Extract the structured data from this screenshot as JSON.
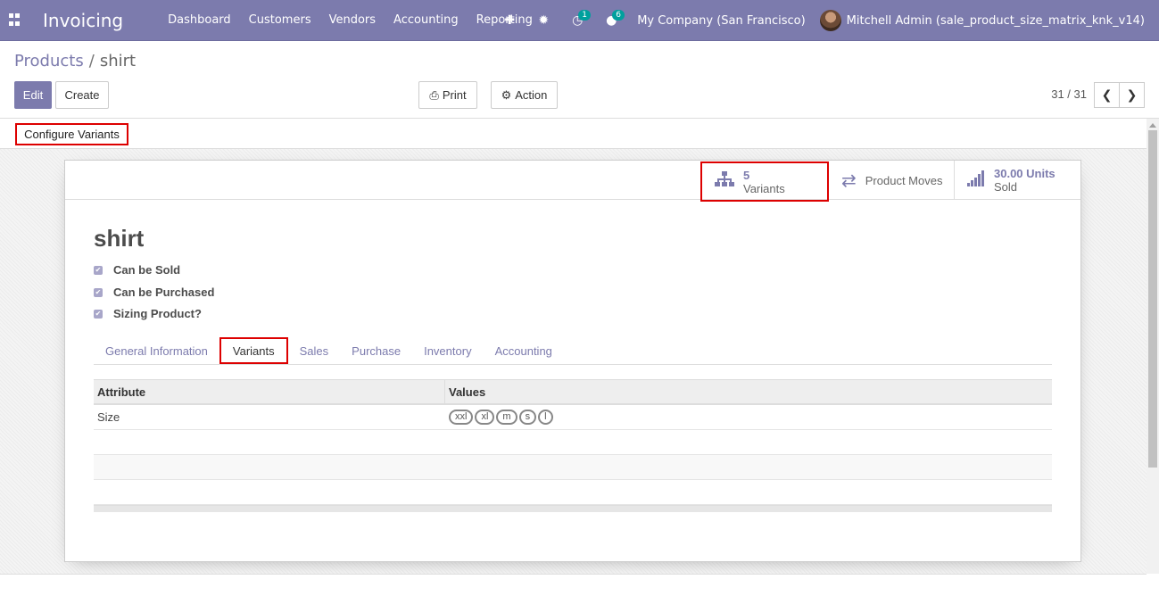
{
  "navbar": {
    "brand": "Invoicing",
    "menu": [
      "Dashboard",
      "Customers",
      "Vendors",
      "Accounting",
      "Reporting"
    ],
    "activity_count": "1",
    "message_count": "6",
    "company": "My Company (San Francisco)",
    "user": "Mitchell Admin (sale_product_size_matrix_knk_v14)"
  },
  "breadcrumb": {
    "parent": "Products",
    "separator": "/",
    "current": "shirt"
  },
  "buttons": {
    "edit": "Edit",
    "create": "Create",
    "print": "Print",
    "action": "Action",
    "configure_variants": "Configure Variants"
  },
  "pager": {
    "value": "31 / 31"
  },
  "stat_buttons": {
    "variants_count": "5",
    "variants_label": "Variants",
    "moves_label": "Product Moves",
    "sold_value": "30.00 Units",
    "sold_label": "Sold"
  },
  "product": {
    "name": "shirt",
    "checks": [
      {
        "label": "Can be Sold",
        "checked": true
      },
      {
        "label": "Can be Purchased",
        "checked": true
      },
      {
        "label": "Sizing Product?",
        "checked": true
      }
    ]
  },
  "tabs": [
    "General Information",
    "Variants",
    "Sales",
    "Purchase",
    "Inventory",
    "Accounting"
  ],
  "active_tab": "Variants",
  "attributes": {
    "columns": [
      "Attribute",
      "Values"
    ],
    "rows": [
      {
        "attribute": "Size",
        "values": [
          "xxl",
          "xl",
          "m",
          "s",
          "l"
        ]
      }
    ]
  },
  "colors": {
    "brand": "#7c7bad",
    "highlight": "#dd0000"
  }
}
